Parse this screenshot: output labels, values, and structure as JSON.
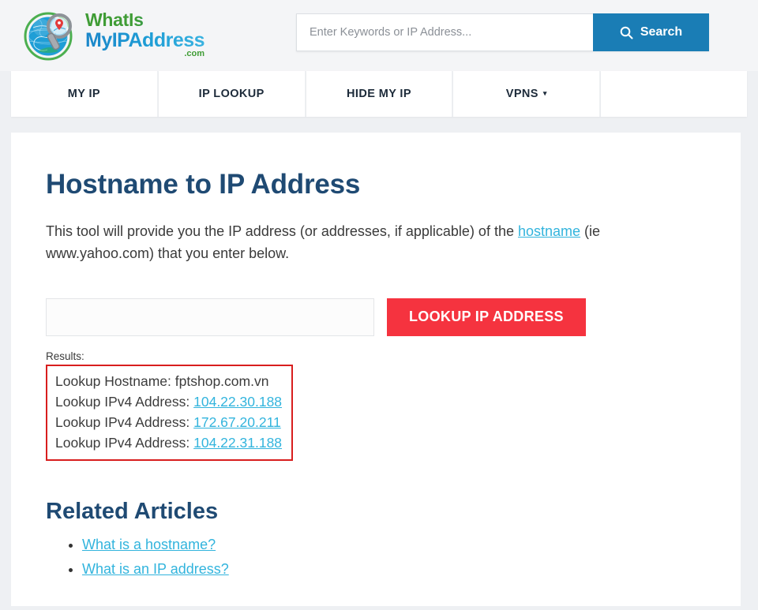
{
  "header": {
    "logo": {
      "line1": "WhatIs",
      "line2": "MyIPAddress",
      "suffix": ".com",
      "colors": {
        "green": "#3f9c35",
        "blue": "#1f9ed6"
      }
    },
    "search": {
      "placeholder": "Enter Keywords or IP Address...",
      "value": "",
      "button_label": "Search",
      "button_color": "#1a7db5",
      "icon": "search-icon"
    }
  },
  "nav": {
    "items": [
      {
        "label": "MY IP",
        "has_caret": false
      },
      {
        "label": "IP LOOKUP",
        "has_caret": false
      },
      {
        "label": "HIDE MY IP",
        "has_caret": false
      },
      {
        "label": "VPNS",
        "has_caret": true,
        "caret": "▾"
      },
      {
        "label": "",
        "has_caret": false
      }
    ]
  },
  "main": {
    "title": "Hostname to IP Address",
    "intro_part1": "This tool will provide you the IP address (or addresses, if applicable) of the ",
    "intro_link": "hostname",
    "intro_part2": " (ie www.yahoo.com) that you enter below.",
    "form": {
      "input_value": "",
      "input_placeholder": "",
      "button_label": "LOOKUP IP ADDRESS",
      "button_color": "#f5333f"
    },
    "results": {
      "label": "Results:",
      "highlight_color": "#d81e1e",
      "lines": [
        {
          "prefix": "Lookup Hostname: ",
          "value": "fptshop.com.vn",
          "is_link": false
        },
        {
          "prefix": "Lookup IPv4 Address: ",
          "value": "104.22.30.188",
          "is_link": true
        },
        {
          "prefix": "Lookup IPv4 Address: ",
          "value": "172.67.20.211",
          "is_link": true
        },
        {
          "prefix": "Lookup IPv4 Address: ",
          "value": "104.22.31.188",
          "is_link": true
        }
      ]
    },
    "related": {
      "title": "Related Articles",
      "links": [
        "What is a hostname?",
        "What is an IP address?"
      ]
    }
  },
  "theme": {
    "page_background": "#eef0f3",
    "card_background": "#ffffff",
    "heading_color": "#1f4a73",
    "link_color": "#32b4dd"
  }
}
